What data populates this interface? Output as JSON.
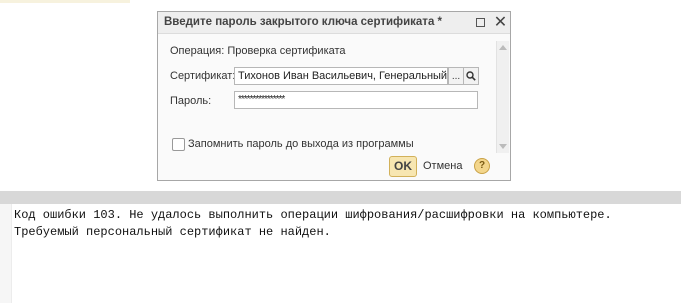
{
  "dialog": {
    "title": "Введите пароль закрытого ключа сертификата *",
    "operation": "Операция: Проверка сертификата",
    "certificate_label": "Сертификат:",
    "certificate_value": "Тихонов Иван Васильевич, Генеральный",
    "certificate_select": "...",
    "password_label": "Пароль:",
    "password_value": "****************",
    "remember_label": "Запомнить пароль до выхода из программы",
    "ok_label": "OK",
    "cancel_label": "Отмена",
    "help_label": "?",
    "icons": [
      "maximize-icon",
      "close-icon",
      "search-icon",
      "help-icon"
    ]
  },
  "output": {
    "line1": "Код ошибки 103. Не удалось выполнить операции шифрования/расшифровки на компьютере.",
    "line2": "Требуемый персональный сертификат не найден."
  },
  "colors": {
    "accent_button": "#f7e6b1",
    "divider": "#d8d8d8"
  }
}
